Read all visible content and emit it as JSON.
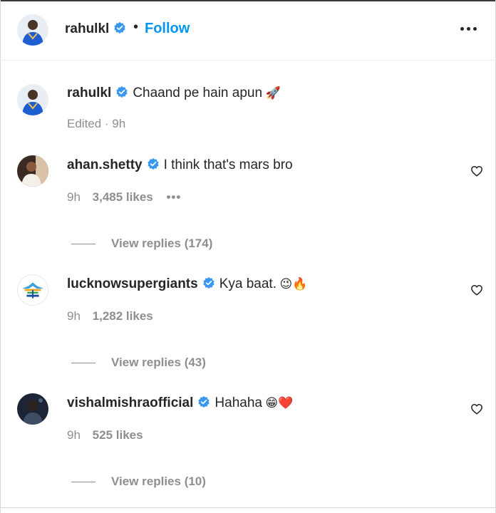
{
  "header": {
    "username": "rahulkl",
    "separator": "•",
    "follow_label": "Follow",
    "more_icon": "more-horizontal-icon"
  },
  "caption": {
    "username": "rahulkl",
    "text": "Chaand pe hain apun",
    "emoji": "🚀",
    "meta": "Edited · 9h"
  },
  "comments": [
    {
      "username": "ahan.shetty",
      "text": "I think that's mars bro",
      "emoji": "",
      "time": "9h",
      "likes": "3,485 likes",
      "has_more": true,
      "view_replies": "View replies (174)"
    },
    {
      "username": "lucknowsupergiants",
      "text": "Kya baat.",
      "emoji": "😉🔥",
      "time": "9h",
      "likes": "1,282 likes",
      "has_more": false,
      "view_replies": "View replies (43)"
    },
    {
      "username": "vishalmishraofficial",
      "text": "Hahaha",
      "emoji": "😁❤️",
      "time": "9h",
      "likes": "525 likes",
      "has_more": false,
      "view_replies": "View replies (10)"
    }
  ],
  "colors": {
    "accent": "#0095f6",
    "verified": "#3897f0",
    "secondary_text": "#8e8e8e"
  }
}
